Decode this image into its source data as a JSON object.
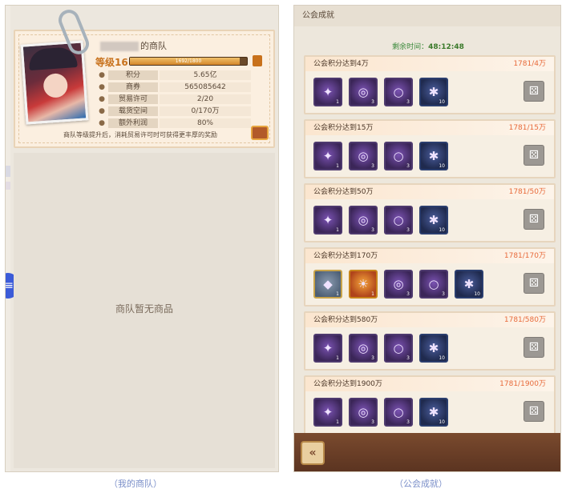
{
  "left_panel": {
    "team_name": "的商队",
    "level_text": "等级16",
    "level_bar_text": "1692/1800",
    "level_progress": 0.94,
    "stats": [
      {
        "icon": "coin-icon",
        "label": "积分",
        "value": "5.65亿"
      },
      {
        "icon": "phone-icon",
        "label": "商券",
        "value": "565085642"
      },
      {
        "icon": "license-icon",
        "label": "贸易许可",
        "value": "2/20"
      },
      {
        "icon": "cargo-icon",
        "label": "载货空间",
        "value": "0/170万"
      },
      {
        "icon": "bag-icon",
        "label": "额外利润",
        "value": "80%"
      }
    ],
    "hint": "商队等级提升后，消耗贸易许可时可获得更丰厚的奖励",
    "empty_text": "商队暂无商品",
    "caption": "（我的商队）"
  },
  "right_panel": {
    "title": "公会成就",
    "timer_label": "剩余时间：",
    "timer_value": "48:12:48",
    "achievements": [
      {
        "title": "公会积分达到4万",
        "progress": "1781/4万",
        "items": [
          {
            "glyph": "✦",
            "count": "1",
            "style": ""
          },
          {
            "glyph": "◎",
            "count": "3",
            "style": ""
          },
          {
            "glyph": "○",
            "count": "3",
            "style": ""
          },
          {
            "glyph": "✱",
            "count": "10",
            "style": "blue"
          }
        ]
      },
      {
        "title": "公会积分达到15万",
        "progress": "1781/15万",
        "items": [
          {
            "glyph": "✦",
            "count": "1",
            "style": ""
          },
          {
            "glyph": "◎",
            "count": "3",
            "style": ""
          },
          {
            "glyph": "○",
            "count": "3",
            "style": ""
          },
          {
            "glyph": "✱",
            "count": "10",
            "style": "blue"
          }
        ]
      },
      {
        "title": "公会积分达到50万",
        "progress": "1781/50万",
        "items": [
          {
            "glyph": "✦",
            "count": "1",
            "style": ""
          },
          {
            "glyph": "◎",
            "count": "3",
            "style": ""
          },
          {
            "glyph": "○",
            "count": "3",
            "style": ""
          },
          {
            "glyph": "✱",
            "count": "10",
            "style": "blue"
          }
        ]
      },
      {
        "title": "公会积分达到170万",
        "progress": "1781/170万",
        "items": [
          {
            "glyph": "◆",
            "count": "1",
            "style": "stone"
          },
          {
            "glyph": "☀",
            "count": "1",
            "style": "gold"
          },
          {
            "glyph": "◎",
            "count": "3",
            "style": ""
          },
          {
            "glyph": "○",
            "count": "3",
            "style": ""
          },
          {
            "glyph": "✱",
            "count": "10",
            "style": "blue"
          }
        ]
      },
      {
        "title": "公会积分达到580万",
        "progress": "1781/580万",
        "items": [
          {
            "glyph": "✦",
            "count": "1",
            "style": ""
          },
          {
            "glyph": "◎",
            "count": "3",
            "style": ""
          },
          {
            "glyph": "○",
            "count": "3",
            "style": ""
          },
          {
            "glyph": "✱",
            "count": "10",
            "style": "blue"
          }
        ]
      },
      {
        "title": "公会积分达到1900万",
        "progress": "1781/1900万",
        "items": [
          {
            "glyph": "✦",
            "count": "1",
            "style": ""
          },
          {
            "glyph": "◎",
            "count": "3",
            "style": ""
          },
          {
            "glyph": "○",
            "count": "3",
            "style": ""
          },
          {
            "glyph": "✱",
            "count": "10",
            "style": "blue"
          }
        ]
      }
    ],
    "caption": "（公会成就）"
  },
  "colors": {
    "accent_orange": "#c8711b",
    "progress_red": "#e86a3a",
    "timer_green": "#3a7a2a"
  }
}
